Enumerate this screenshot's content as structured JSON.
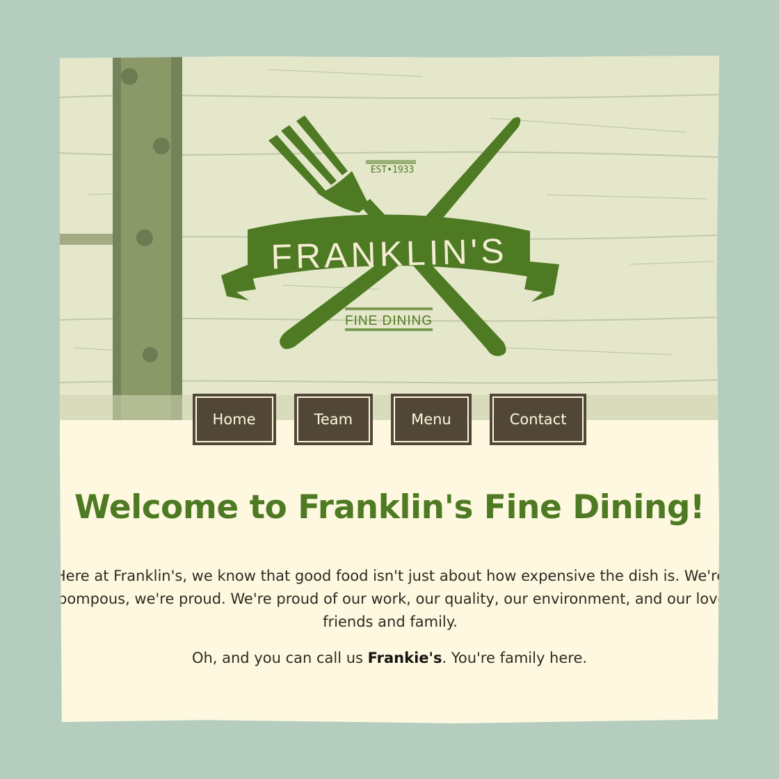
{
  "logo": {
    "name": "FRANKLIN'S",
    "established": "EST•1933",
    "tagline": "FINE DINING"
  },
  "nav": {
    "items": [
      {
        "label": "Home"
      },
      {
        "label": "Team"
      },
      {
        "label": "Menu"
      },
      {
        "label": "Contact"
      }
    ]
  },
  "main": {
    "title": "Welcome to Franklin's Fine Dining!",
    "intro_line1": "Here at Franklin's, we know that good food isn't just about how expensive the dish is. We're",
    "intro_line2": "not pompous, we're proud. We're proud of our work, our quality, our environment, and our love for",
    "intro_line3": "friends and family.",
    "outro_before": "Oh, and you can call us ",
    "outro_nickname": "Frankie's",
    "outro_after": ". You're family here."
  },
  "colors": {
    "background": "#b4cdbf",
    "page": "#fdf8df",
    "brand_green": "#4e7a23",
    "nav_button": "#524737",
    "nav_text": "#fdf8df"
  }
}
